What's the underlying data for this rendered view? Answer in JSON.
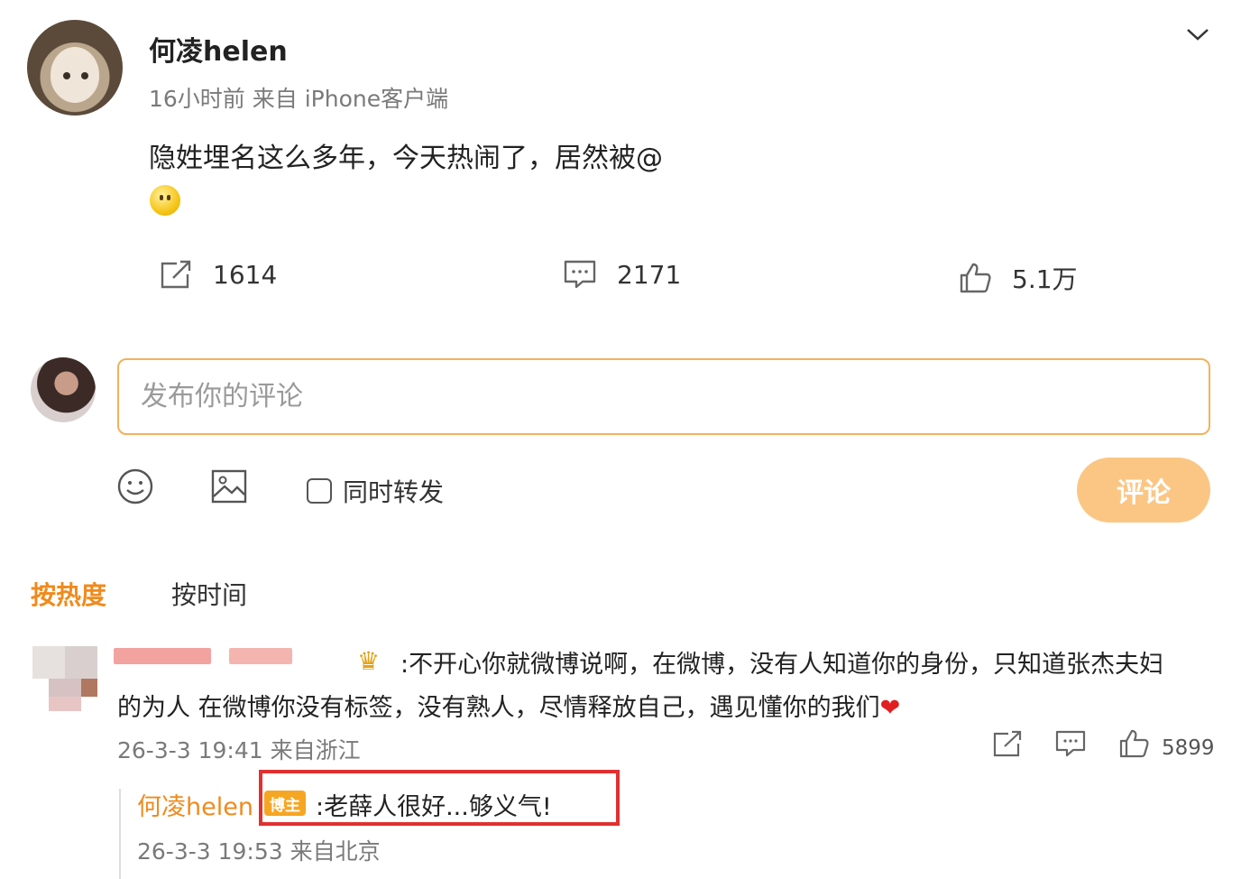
{
  "post": {
    "username": "何凌helen",
    "meta": "16小时前  来自 iPhone客户端",
    "text": "隐姓埋名这么多年，今天热闹了，居然被@",
    "emoji": "smile-emoji"
  },
  "actions": {
    "repost_count": "1614",
    "comment_count": "2171",
    "like_count": "5.1万"
  },
  "composer": {
    "placeholder": "发布你的评论",
    "repost_label": "同时转发",
    "submit_label": "评论"
  },
  "sort_tabs": [
    "按热度",
    "按时间"
  ],
  "comment": {
    "text_line1": ":不开心你就微博说啊，在微博，没有人知道你的身份，只知道张杰夫妇",
    "text_line2": "的为人  在微博你没有标签，没有熟人，尽情释放自己，遇见懂你的我们",
    "meta": "26-3-3 19:41 来自浙江",
    "like_count": "5899"
  },
  "reply": {
    "username": "何凌helen",
    "badge": "博主",
    "text": ":老薛人很好...够义气!",
    "meta": "26-3-3 19:53 来自北京"
  },
  "colors": {
    "accent": "#f08a1c",
    "input_border": "#f3b25c",
    "submit_bg": "#fbc684",
    "highlight": "#e03030"
  }
}
